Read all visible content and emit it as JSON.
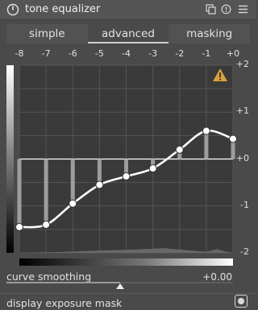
{
  "module": {
    "title": "tone equalizer",
    "icons": [
      "power-icon",
      "presets-icon",
      "reset-icon",
      "menu-icon"
    ]
  },
  "tabs": [
    {
      "label": "simple",
      "active": false
    },
    {
      "label": "advanced",
      "active": true
    },
    {
      "label": "masking",
      "active": false
    }
  ],
  "chart_data": {
    "type": "line",
    "x": [
      -8,
      -7,
      -6,
      -5,
      -4,
      -3,
      -2,
      -1,
      0
    ],
    "x_tick_labels": [
      "-8",
      "-7",
      "-6",
      "-5",
      "-4",
      "-3",
      "-2",
      "-1",
      "+0"
    ],
    "y_tick_labels": [
      "+2",
      "+1",
      "+0",
      "-1",
      "-2"
    ],
    "xlim": [
      -8,
      0
    ],
    "ylim": [
      -2,
      2
    ],
    "series": [
      {
        "values": [
          -1.45,
          -1.4,
          -0.95,
          -0.55,
          -0.37,
          -0.2,
          0.2,
          0.6,
          0.43
        ]
      }
    ],
    "histogram": [
      0,
      0.02,
      0.03,
      0.04,
      0.06,
      0.08,
      0.1,
      0.12,
      0.14,
      0.15,
      0.17,
      0.2,
      0.22,
      0.25,
      0.2,
      0.15,
      0.1,
      0.06,
      0.2,
      0.04
    ],
    "grid": true,
    "warning_icon": "warning-icon"
  },
  "curve_smoothing": {
    "label": "curve smoothing",
    "value": "+0.00",
    "fraction": 0.5
  },
  "exposure_mask": {
    "label": "display exposure mask",
    "toggle_icon": "circle-toggle-icon"
  },
  "colors": {
    "curve": "#ffffff",
    "grid": "#555555",
    "warning": "#d9a038",
    "bars": "#9d9d9d"
  }
}
